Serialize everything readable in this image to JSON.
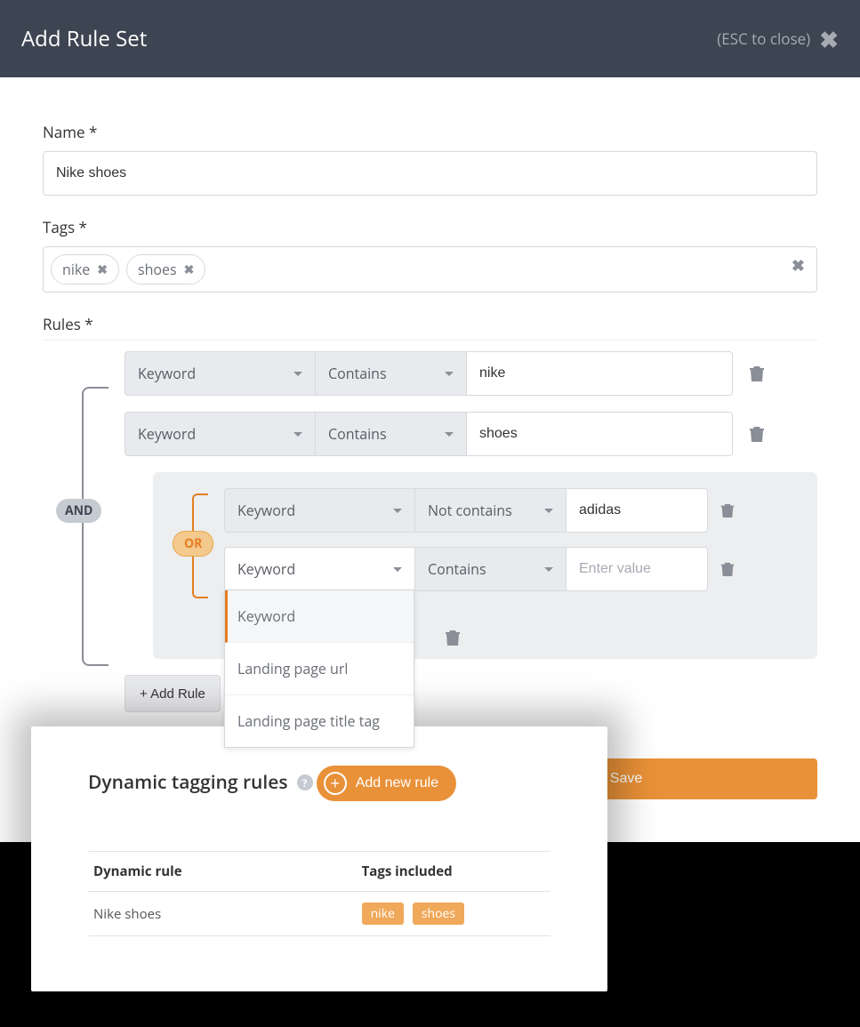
{
  "header": {
    "title": "Add Rule Set",
    "esc_hint": "(ESC to close)"
  },
  "labels": {
    "name": "Name *",
    "tags": "Tags *",
    "rules": "Rules *"
  },
  "name_value": "Nike shoes",
  "tags": [
    "nike",
    "shoes"
  ],
  "badges": {
    "and": "AND",
    "or": "OR"
  },
  "rule1": {
    "field": "Keyword",
    "op": "Contains",
    "value": "nike"
  },
  "rule2": {
    "field": "Keyword",
    "op": "Contains",
    "value": "shoes"
  },
  "or_rule1": {
    "field": "Keyword",
    "op": "Not contains",
    "value": "adidas"
  },
  "or_rule2": {
    "field": "Keyword",
    "op": "Contains",
    "placeholder": "Enter value"
  },
  "dropdown_options": {
    "o1": "Keyword",
    "o2": "Landing page url",
    "o3": "Landing page title tag"
  },
  "buttons": {
    "add_rule": "+ Add Rule",
    "save": "Save",
    "add_new_rule": "Add new rule"
  },
  "card": {
    "title": "Dynamic tagging rules",
    "col1": "Dynamic rule",
    "col2": "Tags included",
    "row_rule": "Nike shoes",
    "row_tags": [
      "nike",
      "shoes"
    ]
  }
}
